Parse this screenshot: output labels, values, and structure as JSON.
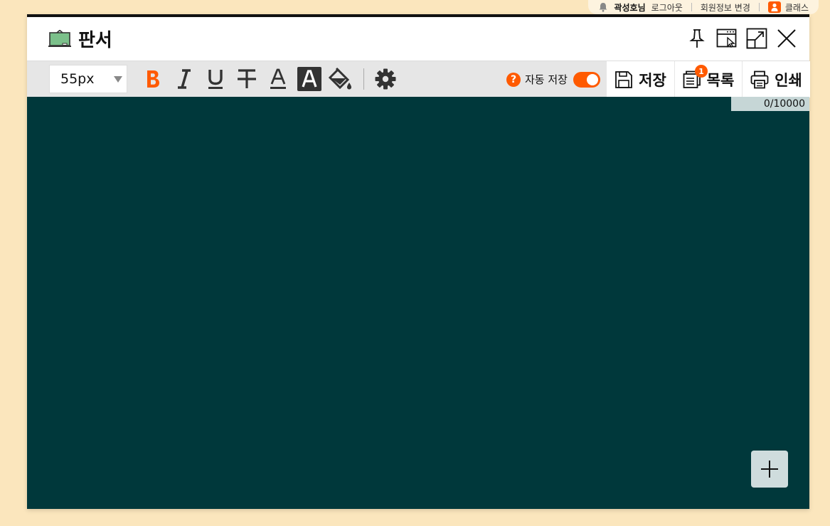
{
  "userbar": {
    "user_name": "곽성호님",
    "logout": "로그아웃",
    "profile": "회원정보 변경",
    "class": "클래스"
  },
  "window": {
    "title": "판서"
  },
  "toolbar": {
    "font_size": "55px",
    "autosave_label": "자동 저장",
    "autosave_help": "?",
    "autosave_on": true,
    "save_label": "저장",
    "list_label": "목록",
    "list_badge": "1",
    "print_label": "인쇄"
  },
  "board": {
    "counter": "0/10000",
    "background": "#00383b"
  },
  "colors": {
    "accent": "#ff5a00",
    "board": "#00383b",
    "page_bg": "#fbe6bd"
  }
}
